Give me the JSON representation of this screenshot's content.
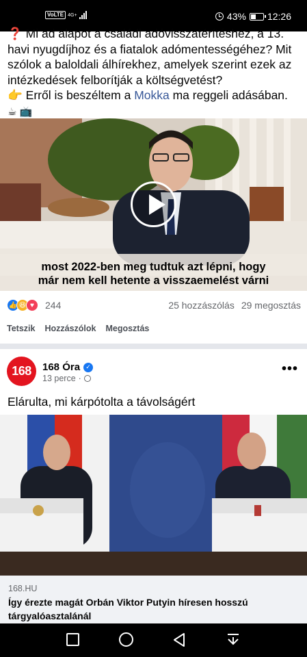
{
  "status_bar": {
    "network": "VoLTE",
    "network_type": "4G+",
    "alarm_icon": "alarm-icon",
    "battery_percent": "43%",
    "battery_level": 0.43,
    "time": "12:26"
  },
  "post1": {
    "line1": "❓ Mi ad alapot a családi adóvisszatérítéshez, a 13. havi nyugdíjhoz és a fiatalok adómentességéhez? Mit szólok a baloldali álhírekhez, amelyek szerint ezek az intézkedések felborítják a költségvetést?",
    "line2_prefix": "👉 Erről is beszéltem a ",
    "line2_link": "Mokka",
    "line2_suffix": " ma reggeli adásában.",
    "emojis": "☕ 📺",
    "video_caption_1": "most 2022-ben meg tudtuk azt lépni, hogy",
    "video_caption_2": "már nem kell hetente a visszaemelést várni",
    "reaction_count": "244",
    "comments": "25 hozzászólás",
    "shares": "29 megosztás",
    "actions": {
      "like": "Tetszik",
      "comment": "Hozzászólok",
      "share": "Megosztás"
    }
  },
  "post2": {
    "avatar_text": "168",
    "page_name": "168 Óra",
    "time": "13 perce",
    "text": "Elárulta, mi kárpótolta a távolságért",
    "link_domain": "168.HU",
    "link_headline": "Így érezte magát Orbán Viktor Putyin híresen hosszú tárgyalóasztalánál"
  },
  "colors": {
    "link": "#385898",
    "facebook_blue": "#1877f2",
    "brand_168": "#e3141f",
    "divider": "#e4e6eb"
  }
}
